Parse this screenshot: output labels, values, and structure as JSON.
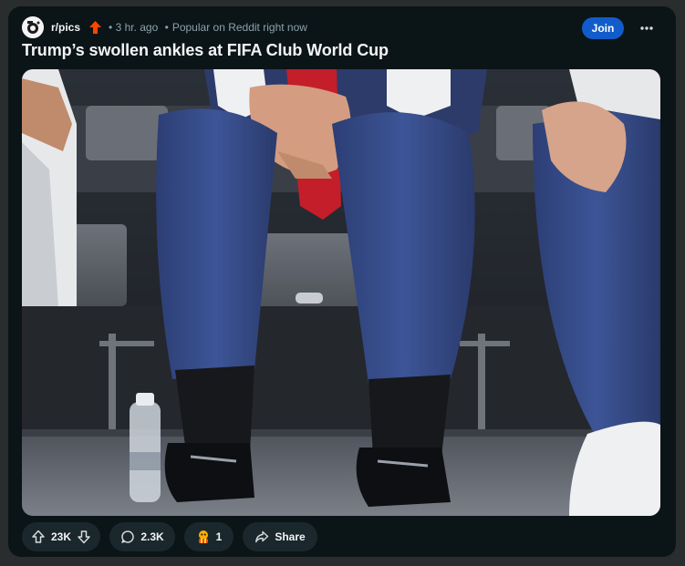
{
  "post": {
    "subreddit": "r/pics",
    "time_ago": "3 hr. ago",
    "context": "Popular on Reddit right now",
    "separator": "•",
    "title": "Trump’s swollen ankles at FIFA Club World Cup",
    "join_label": "Join",
    "more_label": "•••",
    "accent_color": "#ff4500",
    "join_color": "#115bca"
  },
  "actions": {
    "upvotes": "23K",
    "comments": "2.3K",
    "awards": "1",
    "share_label": "Share"
  },
  "icons": {
    "popular": "arrow-up-popular-icon",
    "upvote": "arrow-up-outline-icon",
    "downvote": "arrow-down-outline-icon",
    "comment": "speech-bubble-icon",
    "award": "award-icon",
    "share": "share-arrow-icon"
  }
}
